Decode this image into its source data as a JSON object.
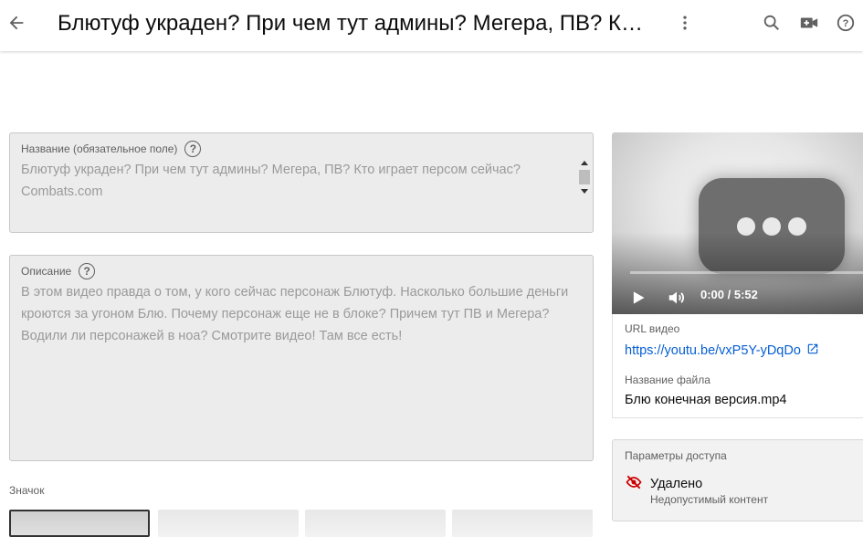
{
  "header": {
    "title": "Блютуф украден? При чем тут админы? Мегера, ПВ? К…",
    "back_icon": "arrow-back-icon",
    "icons": [
      "more-vert-icon",
      "search-icon",
      "add-video-icon",
      "help-icon"
    ]
  },
  "title_field": {
    "label": "Название (обязательное поле)",
    "value": "Блютуф украден? При чем тут админы? Мегера, ПВ? Кто играет персом сейчас? Combats.com"
  },
  "description_field": {
    "label": "Описание",
    "value": "В этом видео правда о том, у кого сейчас персонаж Блютуф. Насколько большие деньги кроются за угоном Блю. Почему персонаж еще не в блоке? Причем тут ПВ и Мегера? Водили ли персонажей в ноа? Смотрите видео! Там все есть!"
  },
  "thumbnail": {
    "label": "Значок"
  },
  "player": {
    "time": "0:00 / 5:52"
  },
  "video_info": {
    "url_label": "URL видео",
    "url": "https://youtu.be/vxP5Y-yDqDo",
    "filename_label": "Название файла",
    "filename": "Блю конечная версия.mp4"
  },
  "access": {
    "label": "Параметры доступа",
    "status": "Удалено",
    "reason": "Недопустимый контент",
    "status_color": "#cc0000"
  },
  "colors": {
    "link": "#065fd4",
    "field_bg": "#ececec"
  }
}
